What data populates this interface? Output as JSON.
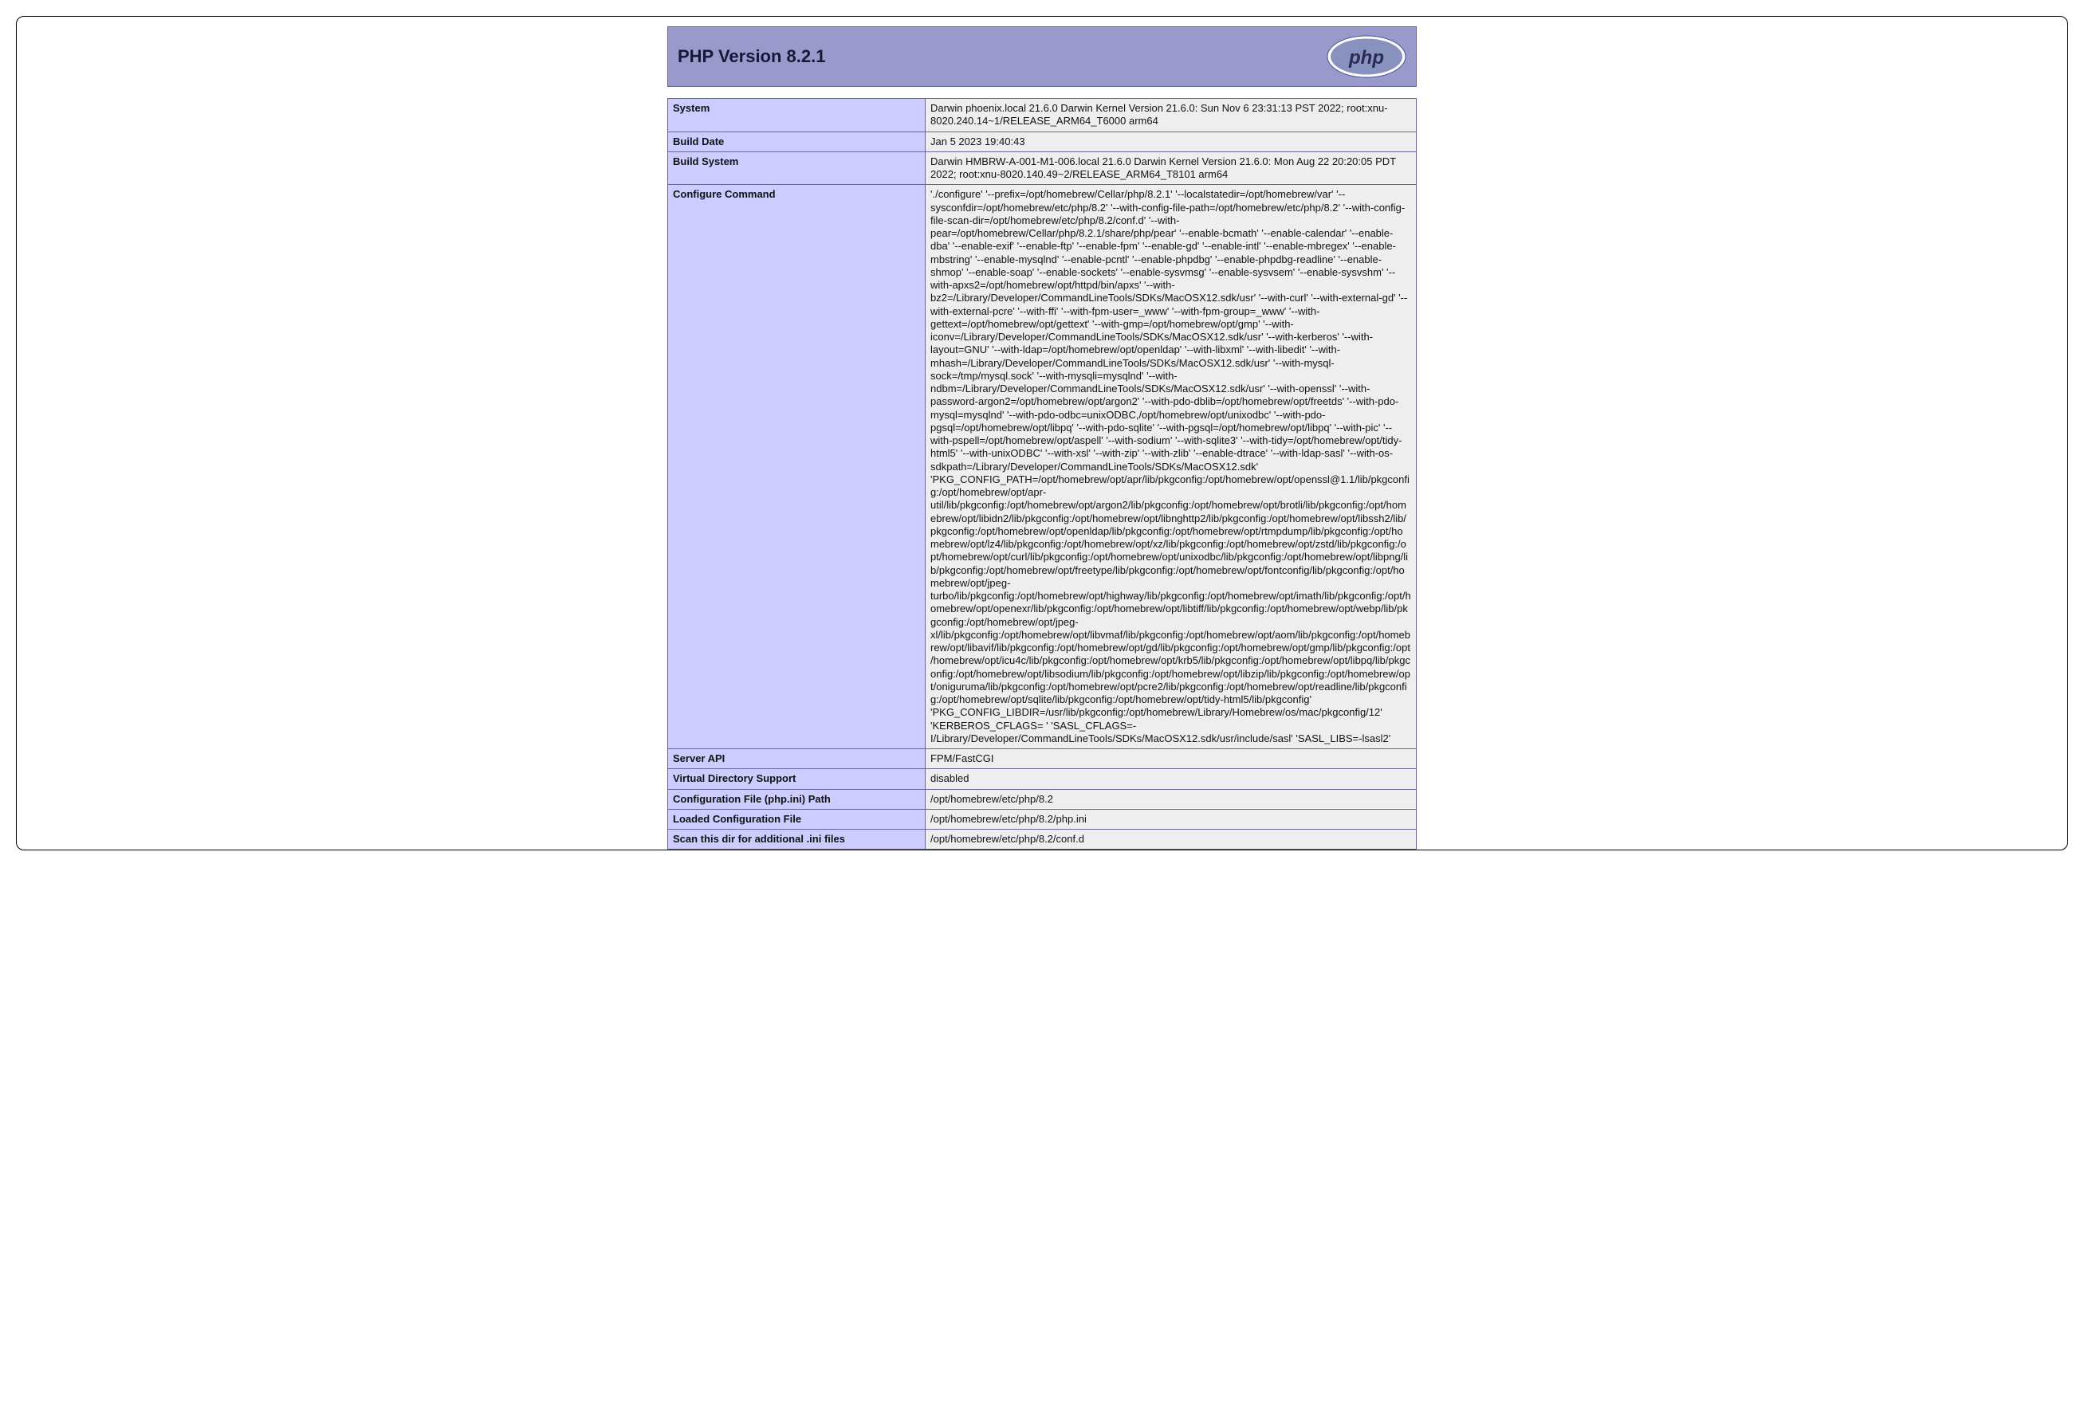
{
  "header": {
    "title": "PHP Version 8.2.1",
    "logo_text": "php"
  },
  "rows": [
    {
      "key": "System",
      "value": "Darwin phoenix.local 21.6.0 Darwin Kernel Version 21.6.0: Sun Nov 6 23:31:13 PST 2022; root:xnu-8020.240.14~1/RELEASE_ARM64_T6000 arm64"
    },
    {
      "key": "Build Date",
      "value": "Jan 5 2023 19:40:43"
    },
    {
      "key": "Build System",
      "value": "Darwin HMBRW-A-001-M1-006.local 21.6.0 Darwin Kernel Version 21.6.0: Mon Aug 22 20:20:05 PDT 2022; root:xnu-8020.140.49~2/RELEASE_ARM64_T8101 arm64"
    },
    {
      "key": "Configure Command",
      "value": "'./configure' '--prefix=/opt/homebrew/Cellar/php/8.2.1' '--localstatedir=/opt/homebrew/var' '--sysconfdir=/opt/homebrew/etc/php/8.2' '--with-config-file-path=/opt/homebrew/etc/php/8.2' '--with-config-file-scan-dir=/opt/homebrew/etc/php/8.2/conf.d' '--with-pear=/opt/homebrew/Cellar/php/8.2.1/share/php/pear' '--enable-bcmath' '--enable-calendar' '--enable-dba' '--enable-exif' '--enable-ftp' '--enable-fpm' '--enable-gd' '--enable-intl' '--enable-mbregex' '--enable-mbstring' '--enable-mysqlnd' '--enable-pcntl' '--enable-phpdbg' '--enable-phpdbg-readline' '--enable-shmop' '--enable-soap' '--enable-sockets' '--enable-sysvmsg' '--enable-sysvsem' '--enable-sysvshm' '--with-apxs2=/opt/homebrew/opt/httpd/bin/apxs' '--with-bz2=/Library/Developer/CommandLineTools/SDKs/MacOSX12.sdk/usr' '--with-curl' '--with-external-gd' '--with-external-pcre' '--with-ffi' '--with-fpm-user=_www' '--with-fpm-group=_www' '--with-gettext=/opt/homebrew/opt/gettext' '--with-gmp=/opt/homebrew/opt/gmp' '--with-iconv=/Library/Developer/CommandLineTools/SDKs/MacOSX12.sdk/usr' '--with-kerberos' '--with-layout=GNU' '--with-ldap=/opt/homebrew/opt/openldap' '--with-libxml' '--with-libedit' '--with-mhash=/Library/Developer/CommandLineTools/SDKs/MacOSX12.sdk/usr' '--with-mysql-sock=/tmp/mysql.sock' '--with-mysqli=mysqlnd' '--with-ndbm=/Library/Developer/CommandLineTools/SDKs/MacOSX12.sdk/usr' '--with-openssl' '--with-password-argon2=/opt/homebrew/opt/argon2' '--with-pdo-dblib=/opt/homebrew/opt/freetds' '--with-pdo-mysql=mysqlnd' '--with-pdo-odbc=unixODBC,/opt/homebrew/opt/unixodbc' '--with-pdo-pgsql=/opt/homebrew/opt/libpq' '--with-pdo-sqlite' '--with-pgsql=/opt/homebrew/opt/libpq' '--with-pic' '--with-pspell=/opt/homebrew/opt/aspell' '--with-sodium' '--with-sqlite3' '--with-tidy=/opt/homebrew/opt/tidy-html5' '--with-unixODBC' '--with-xsl' '--with-zip' '--with-zlib' '--enable-dtrace' '--with-ldap-sasl' '--with-os-sdkpath=/Library/Developer/CommandLineTools/SDKs/MacOSX12.sdk' 'PKG_CONFIG_PATH=/opt/homebrew/opt/apr/lib/pkgconfig:/opt/homebrew/opt/openssl@1.1/lib/pkgconfig:/opt/homebrew/opt/apr-util/lib/pkgconfig:/opt/homebrew/opt/argon2/lib/pkgconfig:/opt/homebrew/opt/brotli/lib/pkgconfig:/opt/homebrew/opt/libidn2/lib/pkgconfig:/opt/homebrew/opt/libnghttp2/lib/pkgconfig:/opt/homebrew/opt/libssh2/lib/pkgconfig:/opt/homebrew/opt/openldap/lib/pkgconfig:/opt/homebrew/opt/rtmpdump/lib/pkgconfig:/opt/homebrew/opt/lz4/lib/pkgconfig:/opt/homebrew/opt/xz/lib/pkgconfig:/opt/homebrew/opt/zstd/lib/pkgconfig:/opt/homebrew/opt/curl/lib/pkgconfig:/opt/homebrew/opt/unixodbc/lib/pkgconfig:/opt/homebrew/opt/libpng/lib/pkgconfig:/opt/homebrew/opt/freetype/lib/pkgconfig:/opt/homebrew/opt/fontconfig/lib/pkgconfig:/opt/homebrew/opt/jpeg-turbo/lib/pkgconfig:/opt/homebrew/opt/highway/lib/pkgconfig:/opt/homebrew/opt/imath/lib/pkgconfig:/opt/homebrew/opt/openexr/lib/pkgconfig:/opt/homebrew/opt/libtiff/lib/pkgconfig:/opt/homebrew/opt/webp/lib/pkgconfig:/opt/homebrew/opt/jpeg-xl/lib/pkgconfig:/opt/homebrew/opt/libvmaf/lib/pkgconfig:/opt/homebrew/opt/aom/lib/pkgconfig:/opt/homebrew/opt/libavif/lib/pkgconfig:/opt/homebrew/opt/gd/lib/pkgconfig:/opt/homebrew/opt/gmp/lib/pkgconfig:/opt/homebrew/opt/icu4c/lib/pkgconfig:/opt/homebrew/opt/krb5/lib/pkgconfig:/opt/homebrew/opt/libpq/lib/pkgconfig:/opt/homebrew/opt/libsodium/lib/pkgconfig:/opt/homebrew/opt/libzip/lib/pkgconfig:/opt/homebrew/opt/oniguruma/lib/pkgconfig:/opt/homebrew/opt/pcre2/lib/pkgconfig:/opt/homebrew/opt/readline/lib/pkgconfig:/opt/homebrew/opt/sqlite/lib/pkgconfig:/opt/homebrew/opt/tidy-html5/lib/pkgconfig' 'PKG_CONFIG_LIBDIR=/usr/lib/pkgconfig:/opt/homebrew/Library/Homebrew/os/mac/pkgconfig/12' 'KERBEROS_CFLAGS= ' 'SASL_CFLAGS=-I/Library/Developer/CommandLineTools/SDKs/MacOSX12.sdk/usr/include/sasl' 'SASL_LIBS=-lsasl2'"
    },
    {
      "key": "Server API",
      "value": "FPM/FastCGI"
    },
    {
      "key": "Virtual Directory Support",
      "value": "disabled"
    },
    {
      "key": "Configuration File (php.ini) Path",
      "value": "/opt/homebrew/etc/php/8.2"
    },
    {
      "key": "Loaded Configuration File",
      "value": "/opt/homebrew/etc/php/8.2/php.ini"
    },
    {
      "key": "Scan this dir for additional .ini files",
      "value": "/opt/homebrew/etc/php/8.2/conf.d"
    }
  ]
}
